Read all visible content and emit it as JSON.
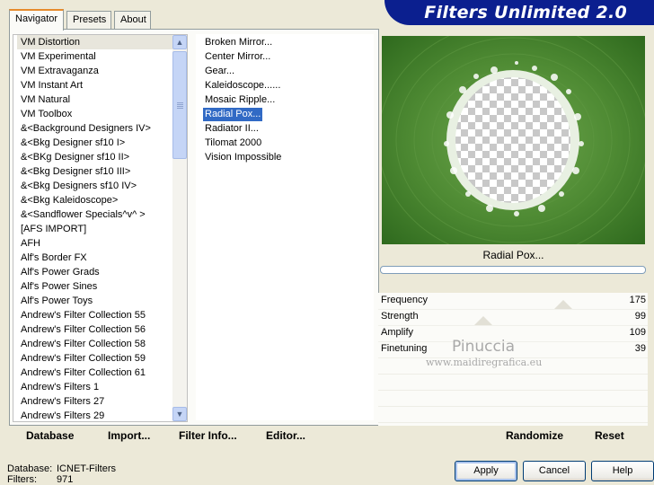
{
  "tabs": [
    {
      "label": "Navigator",
      "active": true
    },
    {
      "label": "Presets",
      "active": false
    },
    {
      "label": "About",
      "active": false
    }
  ],
  "banner": {
    "title": "Filters Unlimited 2.0",
    "color": "#0b1f8f"
  },
  "categories": [
    "VM Distortion",
    "VM Experimental",
    "VM Extravaganza",
    "VM Instant Art",
    "VM Natural",
    "VM Toolbox",
    "&<Background Designers IV>",
    "&<Bkg Designer sf10 I>",
    "&<BKg Designer sf10 II>",
    "&<Bkg Designer sf10 III>",
    "&<Bkg Designers sf10 IV>",
    "&<Bkg Kaleidoscope>",
    "&<Sandflower Specials^v^ >",
    "[AFS IMPORT]",
    "AFH",
    "Alf's Border FX",
    "Alf's Power Grads",
    "Alf's Power Sines",
    "Alf's Power Toys",
    "Andrew's Filter Collection 55",
    "Andrew's Filter Collection 56",
    "Andrew's Filter Collection 58",
    "Andrew's Filter Collection 59",
    "Andrew's Filter Collection 61",
    "Andrew's Filters 1",
    "Andrew's Filters 27",
    "Andrew's Filters 29"
  ],
  "selected_category": "VM Distortion",
  "filters": [
    "Broken Mirror...",
    "Center Mirror...",
    "Gear...",
    "Kaleidoscope......",
    "Mosaic Ripple...",
    "Radial Pox...",
    "Radiator II...",
    "Tilomat 2000",
    "Vision Impossible"
  ],
  "selected_filter": "Radial Pox...",
  "preview": {
    "filter_name": "Radial Pox...",
    "progress": 0
  },
  "parameters": [
    {
      "label": "Frequency",
      "value": "175"
    },
    {
      "label": "Strength",
      "value": "99"
    },
    {
      "label": "Amplify",
      "value": "109"
    },
    {
      "label": "Finetuning",
      "value": "39"
    }
  ],
  "watermark": {
    "name": "Pinuccia",
    "site": "www.maidiregrafica.eu"
  },
  "bottom_buttons": {
    "database": "Database",
    "import": "Import...",
    "filter_info": "Filter Info...",
    "editor": "Editor...",
    "randomize": "Randomize",
    "reset": "Reset"
  },
  "status": {
    "database_label": "Database:",
    "database_value": "ICNET-Filters",
    "filters_label": "Filters:",
    "filters_value": "971"
  },
  "dialog_buttons": {
    "apply": "Apply",
    "cancel": "Cancel",
    "help": "Help"
  },
  "colors": {
    "selection": "#316ac5",
    "preview_green": "#4e8a33",
    "accent_tab": "#e68b2c"
  },
  "icons": {
    "scroll_up": "chevron-up-icon",
    "scroll_down": "chevron-down-icon"
  }
}
